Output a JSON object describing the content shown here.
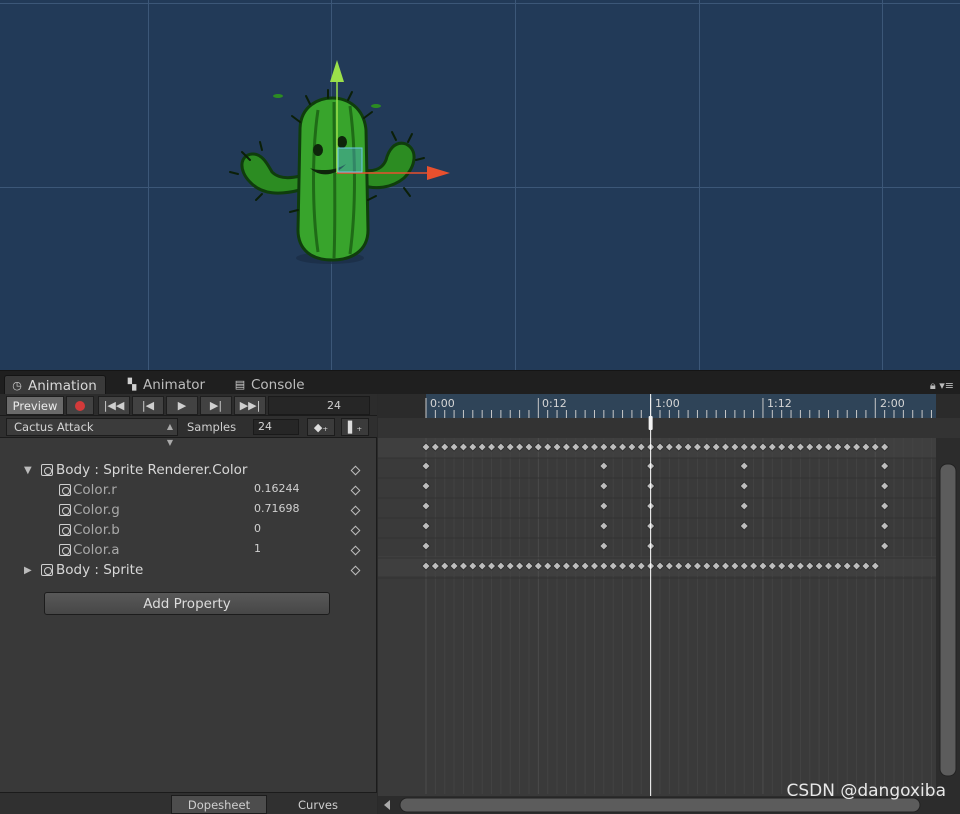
{
  "tabs": [
    {
      "label": "Animation",
      "icon": "clock-icon",
      "active": true
    },
    {
      "label": "Animator",
      "icon": "animator-icon",
      "active": false
    },
    {
      "label": "Console",
      "icon": "console-icon",
      "active": false
    }
  ],
  "toolbar": {
    "preview_label": "Preview",
    "frame_value": "24"
  },
  "clip": {
    "name": "Cactus Attack",
    "samples_label": "Samples",
    "samples_value": "24"
  },
  "properties": [
    {
      "label": "Body : Sprite Renderer.Color",
      "value": "",
      "expanded": true
    },
    {
      "label": "Color.r",
      "value": "0.16244"
    },
    {
      "label": "Color.g",
      "value": "0.71698"
    },
    {
      "label": "Color.b",
      "value": "0"
    },
    {
      "label": "Color.a",
      "value": "1"
    },
    {
      "label": "Body : Sprite",
      "value": "",
      "expanded": false
    }
  ],
  "add_property_label": "Add Property",
  "bottom_tabs": {
    "dopesheet": "Dopesheet",
    "curves": "Curves"
  },
  "ruler": {
    "labels": [
      "0:00",
      "0:12",
      "1:00",
      "1:12",
      "2:00"
    ]
  },
  "watermark": "CSDN @dangoxiba"
}
